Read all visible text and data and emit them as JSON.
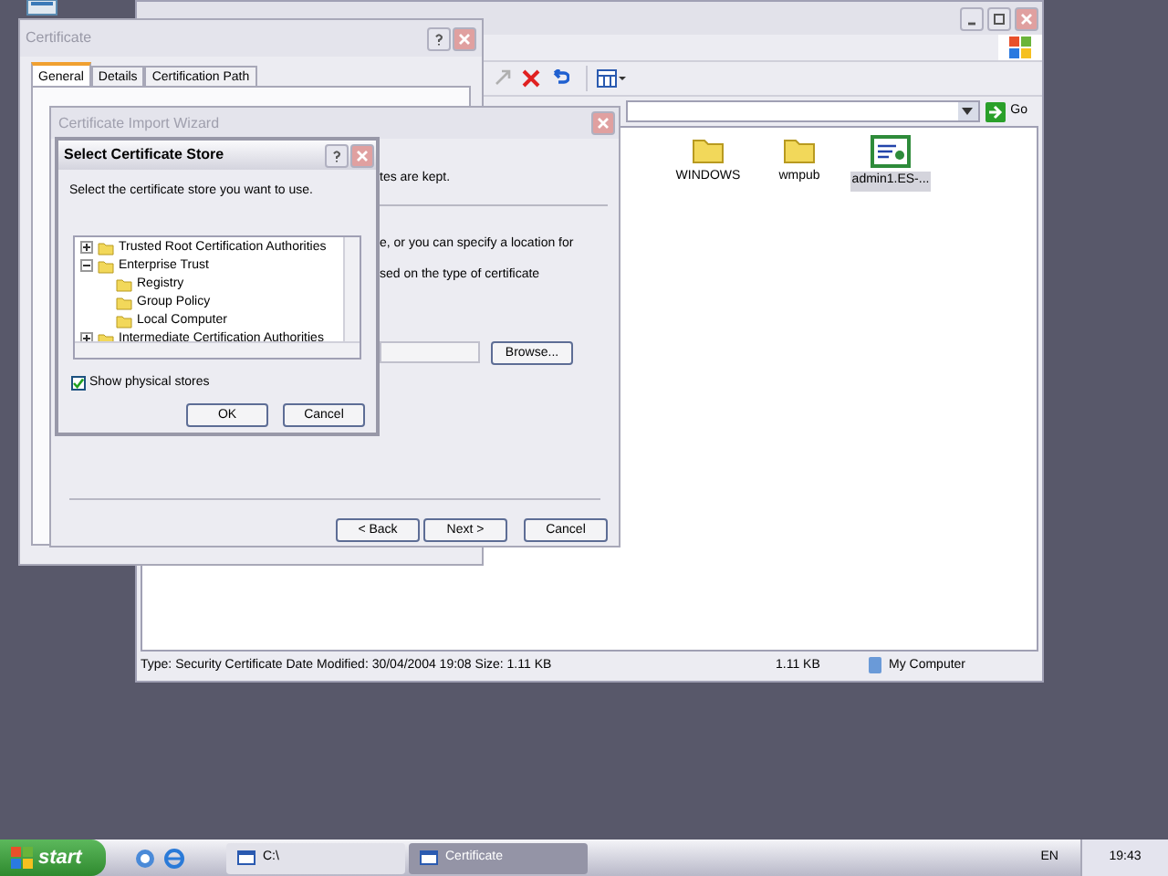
{
  "explorer": {
    "go_label": "Go",
    "items": [
      {
        "name": "WINDOWS",
        "kind": "folder",
        "selected": false
      },
      {
        "name": "wmpub",
        "kind": "folder",
        "selected": false
      },
      {
        "name": "admin1.ES-...",
        "kind": "certificate",
        "selected": true
      }
    ],
    "status_bar": {
      "info": "Type: Security Certificate Date Modified: 30/04/2004 19:08 Size: 1.11 KB",
      "size": "1.11 KB",
      "zone": "My Computer"
    }
  },
  "certificate_window": {
    "title": "Certificate",
    "tabs": [
      {
        "label": "General",
        "selected": true
      },
      {
        "label": "Details",
        "selected": false
      },
      {
        "label": "Certification Path",
        "selected": false
      }
    ]
  },
  "wizard": {
    "title": "Certificate Import Wizard",
    "texts": [
      "tes are kept.",
      "e, or you can specify a location for",
      "sed on the type of certificate"
    ],
    "browse": "Browse...",
    "buttons": [
      "< Back",
      "Next >",
      "Cancel"
    ]
  },
  "store_dialog": {
    "title": "Select Certificate Store",
    "prompt": "Select the certificate store you want to use.",
    "tree": [
      {
        "label": "Trusted Root Certification Authorities",
        "expanded": false
      },
      {
        "label": "Enterprise Trust",
        "expanded": true,
        "children": [
          {
            "label": "Registry"
          },
          {
            "label": "Group Policy"
          },
          {
            "label": "Local Computer"
          }
        ]
      },
      {
        "label": "Intermediate Certification Authorities",
        "expanded": false
      }
    ],
    "show_physical": {
      "label": "Show physical stores",
      "checked": true
    },
    "buttons": [
      "OK",
      "Cancel"
    ]
  },
  "taskbar": {
    "start": "start",
    "tasks": [
      {
        "label": "C:\\",
        "selected": false
      },
      {
        "label": "Certificate",
        "selected": true
      }
    ],
    "language": "EN",
    "clock": "19:43"
  }
}
